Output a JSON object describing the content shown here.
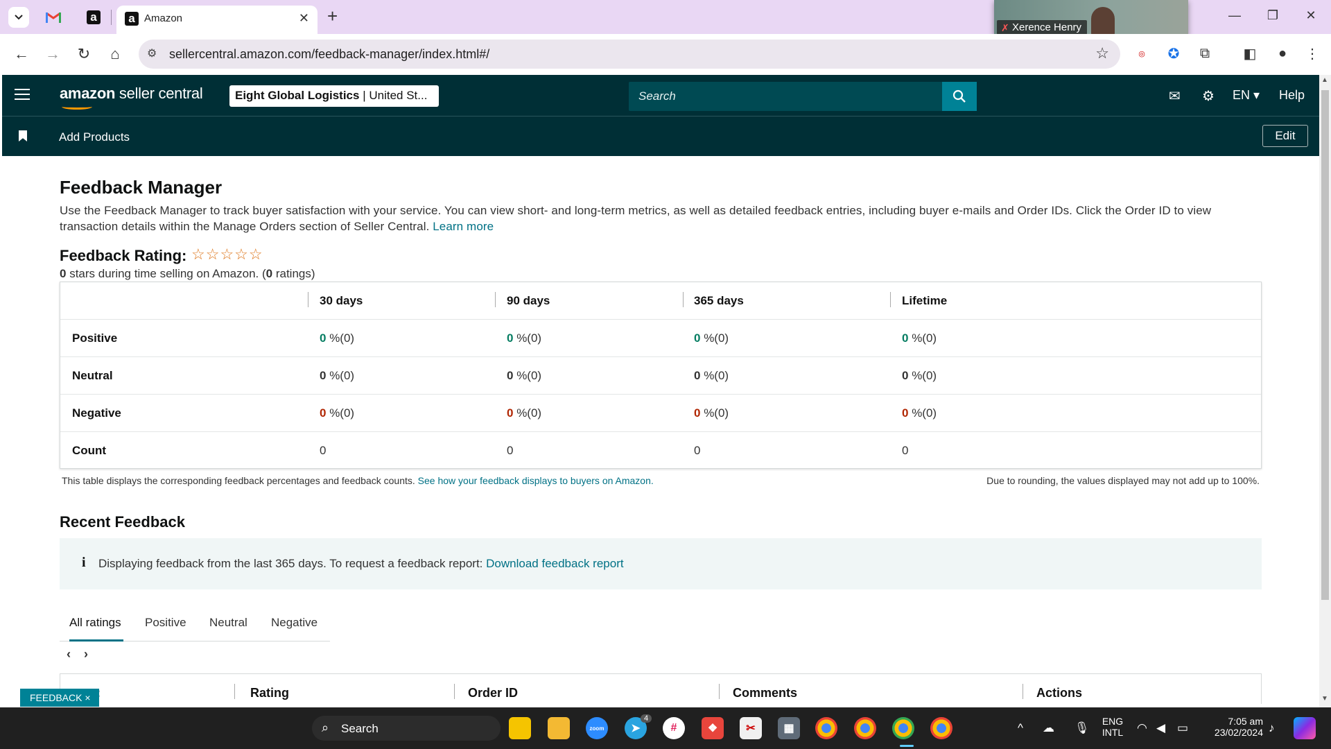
{
  "browser": {
    "tab_title": "Amazon",
    "url": "sellercentral.amazon.com/feedback-manager/index.html#/",
    "video_participant": "Xerence Henry"
  },
  "header": {
    "brand_bold": "amazon",
    "brand_rest": " seller central",
    "account_bold": "Eight Global Logistics",
    "account_rest": " | United St...",
    "search_placeholder": "Search",
    "language": "EN",
    "help": "Help",
    "bookmark_item": "Add Products",
    "edit_label": "Edit"
  },
  "page": {
    "title": "Feedback Manager",
    "intro": "Use the Feedback Manager to track buyer satisfaction with your service. You can view short- and long-term metrics, as well as detailed feedback entries, including buyer e-mails and Order IDs. Click the Order ID to view transaction details within the Manage Orders section of Seller Central.",
    "learn_more": "Learn more",
    "rating_title": "Feedback Rating:",
    "stars": "☆☆☆☆☆",
    "stars_count": "0",
    "stars_note_mid": " stars during time selling on Amazon. (",
    "ratings_count": "0",
    "stars_note_end": " ratings)"
  },
  "feedback_table": {
    "columns": [
      "30 days",
      "90 days",
      "365 days",
      "Lifetime"
    ],
    "rows": [
      {
        "label": "Positive",
        "cells": [
          {
            "value": "0",
            "detail": " %(0)"
          },
          {
            "value": "0",
            "detail": " %(0)"
          },
          {
            "value": "0",
            "detail": " %(0)"
          },
          {
            "value": "0",
            "detail": " %(0)"
          }
        ]
      },
      {
        "label": "Neutral",
        "cells": [
          {
            "value": "0",
            "detail": " %(0)"
          },
          {
            "value": "0",
            "detail": " %(0)"
          },
          {
            "value": "0",
            "detail": " %(0)"
          },
          {
            "value": "0",
            "detail": " %(0)"
          }
        ]
      },
      {
        "label": "Negative",
        "cells": [
          {
            "value": "0",
            "detail": " %(0)"
          },
          {
            "value": "0",
            "detail": " %(0)"
          },
          {
            "value": "0",
            "detail": " %(0)"
          },
          {
            "value": "0",
            "detail": " %(0)"
          }
        ]
      },
      {
        "label": "Count",
        "cells": [
          "0",
          "0",
          "0",
          "0"
        ]
      }
    ],
    "note": "This table displays the corresponding feedback percentages and feedback counts.",
    "note_link": "See how your feedback displays to buyers on Amazon.",
    "rounding_note": "Due to rounding, the values displayed may not add up to 100%."
  },
  "recent": {
    "title": "Recent Feedback",
    "info_icon": "i",
    "info_text": "Displaying feedback from the last 365 days. To request a feedback report:",
    "info_link": "Download feedback report",
    "tabs": [
      "All ratings",
      "Positive",
      "Neutral",
      "Negative"
    ],
    "list_columns": [
      "Rating",
      "Order ID",
      "Comments",
      "Actions"
    ],
    "partial_column": ":"
  },
  "feedback_button": "FEEDBACK ×",
  "taskbar": {
    "search": "Search",
    "lang_top": "ENG",
    "lang_bottom": "INTL",
    "time": "7:05 am",
    "date": "23/02/2024",
    "telegram_badge": "4"
  },
  "colors": {
    "header_bg": "#002f36",
    "link": "#007185",
    "positive": "#067d62",
    "negative": "#b12704",
    "star": "#de7921"
  }
}
